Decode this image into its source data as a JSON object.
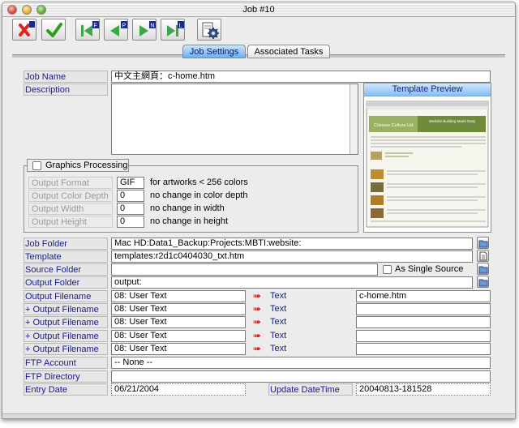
{
  "window": {
    "title": "Job #10"
  },
  "tabs": [
    {
      "label": "Job Settings",
      "active": true
    },
    {
      "label": "Associated Tasks",
      "active": false
    }
  ],
  "toolbar": {
    "nav_badges": {
      "first": "F",
      "previous": "P",
      "next": "N",
      "last": "L"
    }
  },
  "fields": {
    "job_name": {
      "label": "Job Name",
      "value": "中文主網頁：c-home.htm"
    },
    "description": {
      "label": "Description",
      "value": ""
    }
  },
  "graphics": {
    "title": "Graphics Processing",
    "checked": false,
    "rows": [
      {
        "label": "Output Format",
        "value": "GIF",
        "note": "for artworks < 256 colors"
      },
      {
        "label": "Output Color Depth",
        "value": "0",
        "note": "no change in color depth"
      },
      {
        "label": "Output Width",
        "value": "0",
        "note": "no change in width"
      },
      {
        "label": "Output Height",
        "value": "0",
        "note": "no change in height"
      }
    ]
  },
  "preview": {
    "title": "Template Preview",
    "site_name": "Chinese Culture Ltd",
    "slogan": "Website Building Made Easy"
  },
  "folders": {
    "job_folder": {
      "label": "Job Folder",
      "value": "Mac HD:Data1_Backup:Projects:MBTI:website:"
    },
    "template": {
      "label": "Template",
      "value": "templates:r2d1c0404030_txt.htm"
    },
    "source_folder": {
      "label": "Source Folder",
      "value": ""
    },
    "single_source_label": "As Single Source",
    "output_folder": {
      "label": "Output Folder",
      "value": "output:"
    }
  },
  "outputs": [
    {
      "label": "Output Filename",
      "type": "08: User Text",
      "kind": "Text",
      "value": "c-home.htm"
    },
    {
      "label": "+ Output Filename",
      "type": "08: User Text",
      "kind": "Text",
      "value": ""
    },
    {
      "label": "+ Output Filename",
      "type": "08: User Text",
      "kind": "Text",
      "value": ""
    },
    {
      "label": "+ Output Filename",
      "type": "08: User Text",
      "kind": "Text",
      "value": ""
    },
    {
      "label": "+ Output Filename",
      "type": "08: User Text",
      "kind": "Text",
      "value": ""
    }
  ],
  "ftp": {
    "account": {
      "label": "FTP Account",
      "value": "-- None --"
    },
    "directory": {
      "label": "FTP Directory",
      "value": ""
    }
  },
  "dates": {
    "entry": {
      "label": "Entry Date",
      "value": "06/21/2004"
    },
    "update": {
      "label": "Update DateTime",
      "value": "20040813-181528"
    }
  },
  "colors": {
    "label_text": "#1a1a8a",
    "cancel": "#e0241c",
    "confirm": "#2aa01a",
    "nav_green": "#3aa848",
    "active_tab": "#6eaef0"
  }
}
